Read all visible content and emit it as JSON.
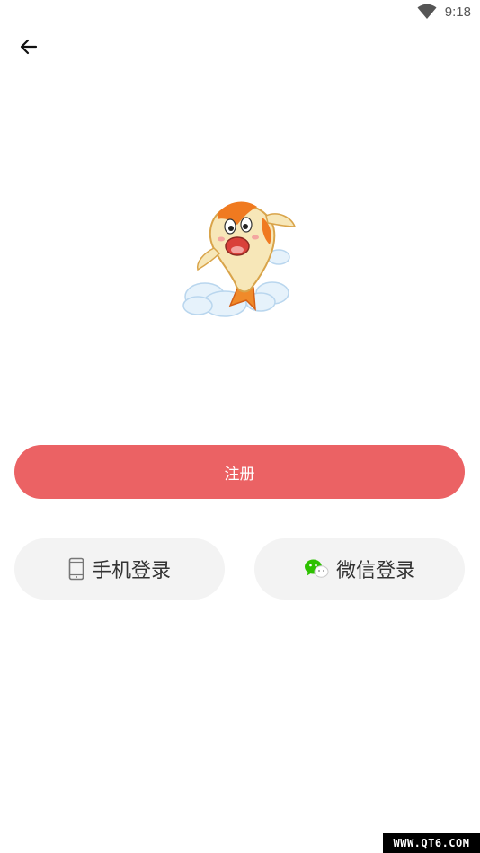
{
  "status_bar": {
    "time": "9:18",
    "wifi_icon": "wifi-icon"
  },
  "header": {
    "back_icon": "arrow-left-icon"
  },
  "mascot": {
    "description_icon": "koi-fish-mascot"
  },
  "register_button": {
    "label": "注册",
    "color": "#eb6264"
  },
  "login_options": {
    "phone": {
      "label": "手机登录",
      "icon": "phone-icon"
    },
    "wechat": {
      "label": "微信登录",
      "icon": "wechat-icon",
      "icon_color": "#2dc100"
    }
  },
  "watermark": {
    "text": "WWW.QT6.COM"
  }
}
